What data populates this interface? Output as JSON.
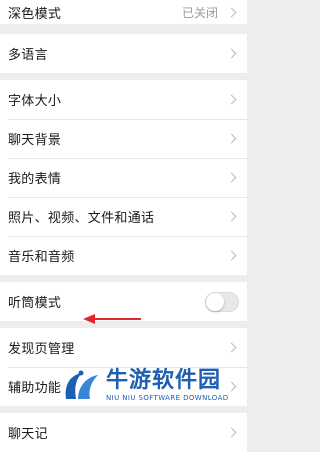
{
  "settings": {
    "group1": {
      "dark_mode": {
        "label": "深色模式",
        "value": "已关闭"
      }
    },
    "group2": {
      "language": {
        "label": "多语言"
      }
    },
    "group3": {
      "items": [
        {
          "label": "字体大小"
        },
        {
          "label": "聊天背景"
        },
        {
          "label": "我的表情"
        },
        {
          "label": "照片、视频、文件和通话"
        },
        {
          "label": "音乐和音频"
        }
      ]
    },
    "group4": {
      "earpiece_mode": {
        "label": "听筒模式",
        "enabled": false
      }
    },
    "group5": {
      "items": [
        {
          "label": "发现页管理"
        },
        {
          "label": "辅助功能"
        }
      ]
    },
    "group6": {
      "chat_history": {
        "label": "聊天记"
      }
    }
  },
  "annotation": {
    "arrow_color": "#e0262b"
  },
  "watermark": {
    "title": "牛游软件园",
    "subtitle": "NIU NIU SOFTWARE DOWNLOAD",
    "color": "#1d5fb0"
  }
}
